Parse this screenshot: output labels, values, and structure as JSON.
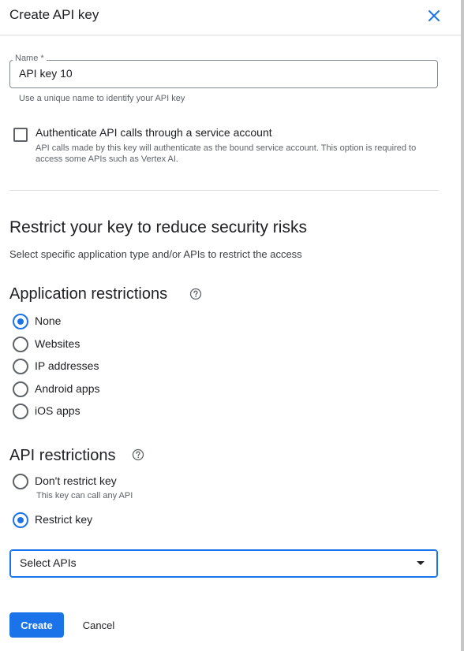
{
  "dialog": {
    "title": "Create API key",
    "close_icon": "close-icon"
  },
  "name_field": {
    "label": "Name *",
    "value": "API key 10",
    "hint": "Use a unique name to identify your API key"
  },
  "service_account": {
    "label": "Authenticate API calls through a service account",
    "description": "API calls made by this key will authenticate as the bound service account. This option is required to access some APIs such as Vertex AI.",
    "checked": false
  },
  "restrict_section": {
    "title": "Restrict your key to reduce security risks",
    "subtitle": "Select specific application type and/or APIs to restrict the access"
  },
  "application_restrictions": {
    "title": "Application restrictions",
    "help_icon": "help-icon",
    "options": [
      {
        "label": "None",
        "checked": true
      },
      {
        "label": "Websites",
        "checked": false
      },
      {
        "label": "IP addresses",
        "checked": false
      },
      {
        "label": "Android apps",
        "checked": false
      },
      {
        "label": "iOS apps",
        "checked": false
      }
    ]
  },
  "api_restrictions": {
    "title": "API restrictions",
    "help_icon": "help-icon",
    "options": [
      {
        "label": "Don't restrict key",
        "description": "This key can call any API",
        "checked": false
      },
      {
        "label": "Restrict key",
        "checked": true
      }
    ],
    "select": {
      "value": "Select APIs",
      "arrow_icon": "dropdown-arrow-icon"
    }
  },
  "actions": {
    "create_label": "Create",
    "cancel_label": "Cancel"
  },
  "colors": {
    "accent": "#1a73e8",
    "text": "#202124",
    "secondary_text": "#5f6368",
    "divider": "#dadce0"
  }
}
